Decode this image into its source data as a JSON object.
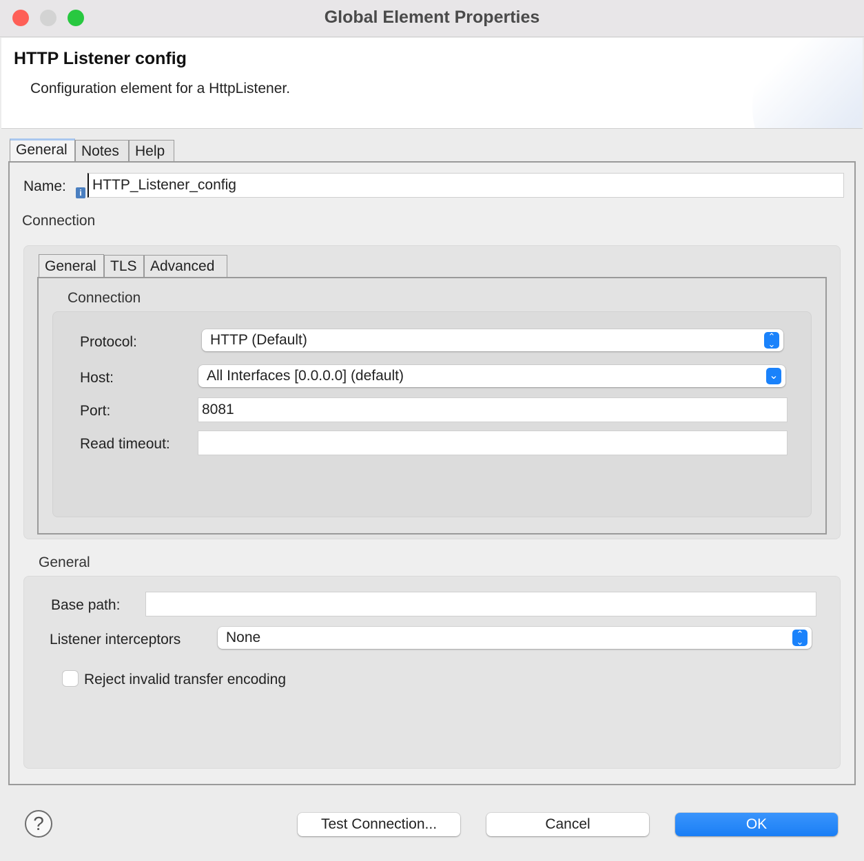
{
  "window": {
    "title": "Global Element Properties"
  },
  "header": {
    "title": "HTTP Listener config",
    "description": "Configuration element for a HttpListener."
  },
  "outer_tabs": [
    {
      "label": "General",
      "active": true
    },
    {
      "label": "Notes"
    },
    {
      "label": "Help"
    }
  ],
  "name": {
    "label": "Name:",
    "value": "HTTP_Listener_config"
  },
  "connection_section": "Connection",
  "inner_tabs": [
    {
      "label": "General",
      "active": true
    },
    {
      "label": "TLS"
    },
    {
      "label": "Advanced"
    }
  ],
  "connection_group": {
    "title": "Connection",
    "protocol": {
      "label": "Protocol:",
      "value": "HTTP (Default)"
    },
    "host": {
      "label": "Host:",
      "value": "All Interfaces [0.0.0.0] (default)"
    },
    "port": {
      "label": "Port:",
      "value": "8081"
    },
    "read_timeout": {
      "label": "Read timeout:",
      "value": ""
    }
  },
  "general_group": {
    "title": "General",
    "base_path": {
      "label": "Base path:",
      "value": ""
    },
    "interceptors": {
      "label": "Listener interceptors",
      "value": "None"
    },
    "reject_checkbox": {
      "label": "Reject invalid transfer encoding",
      "checked": false
    }
  },
  "buttons": {
    "help": "?",
    "test": "Test Connection...",
    "cancel": "Cancel",
    "ok": "OK"
  },
  "colors": {
    "accent": "#1a82fb",
    "close": "#fe5f57",
    "minimize": "#d0d0d0",
    "zoom": "#28c840"
  }
}
